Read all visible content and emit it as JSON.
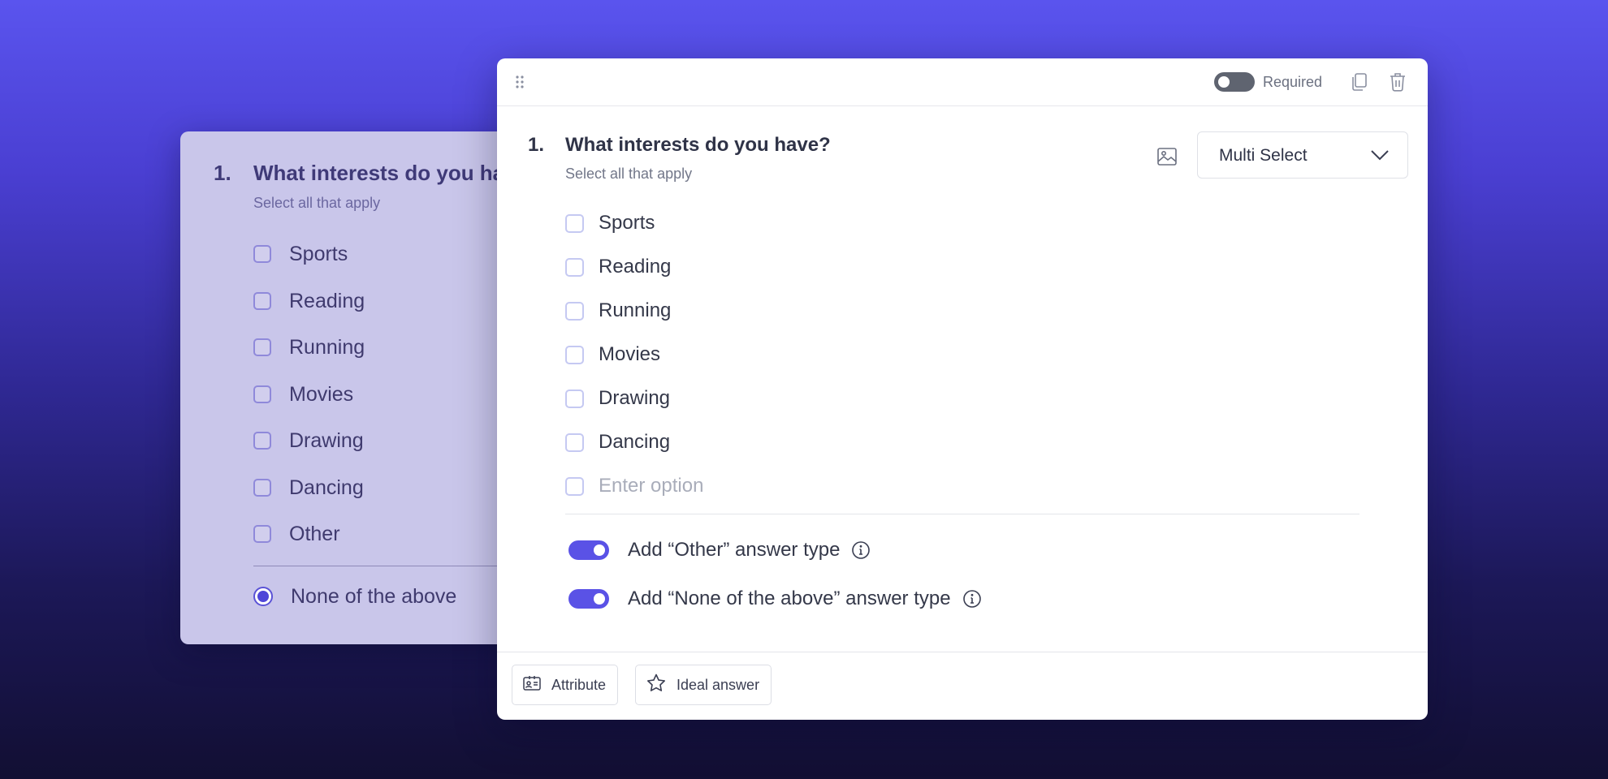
{
  "preview": {
    "number": "1.",
    "question": "What interests do you have?",
    "subtitle": "Select all that apply",
    "options": [
      "Sports",
      "Reading",
      "Running",
      "Movies",
      "Drawing",
      "Dancing",
      "Other"
    ],
    "none_option": "None of the above",
    "none_selected": true
  },
  "editor": {
    "header": {
      "required_label": "Required",
      "required_on": false
    },
    "number": "1.",
    "question": "What interests do you have?",
    "subtitle": "Select all that apply",
    "question_type": "Multi Select",
    "options": [
      "Sports",
      "Reading",
      "Running",
      "Movies",
      "Drawing",
      "Dancing"
    ],
    "new_option_placeholder": "Enter option",
    "toggles": {
      "other_label": "Add “Other” answer type",
      "other_on": true,
      "none_label": "Add “None of the above” answer type",
      "none_on": true
    },
    "footer": {
      "attribute_label": "Attribute",
      "ideal_answer_label": "Ideal answer"
    }
  },
  "colors": {
    "accent": "#5a52e6",
    "background_top": "#5a54ee",
    "background_bottom": "#120f33"
  }
}
